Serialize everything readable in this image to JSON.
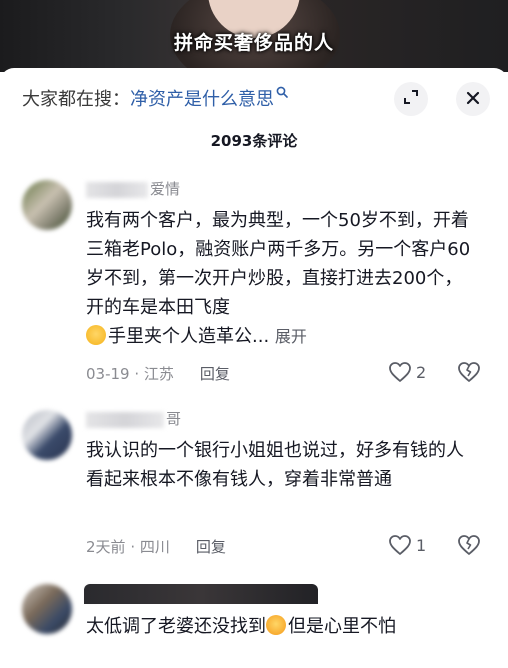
{
  "video": {
    "caption": "拼命买奢侈品的人"
  },
  "search": {
    "prefix": "大家都在搜：",
    "query": "净资产是什么意思"
  },
  "comments_count": "2093条评论",
  "comments": [
    {
      "username": "爱情",
      "text": "我有两个客户，最为典型，一个50岁不到，开着三箱老Polo，融资账户两千多万。另一个客户60岁不到，第一次开户炒股，直接打进去200个，开的车是本田飞度",
      "text_tail": "手里夹个人造革公...",
      "expand": "展开",
      "date": "03-19",
      "location": "江苏",
      "reply": "回复",
      "likes": "2"
    },
    {
      "username": "哥",
      "text": "我认识的一个银行小姐姐也说过，好多有钱的人看起来根本不像有钱人，穿着非常普通",
      "date": "2天前",
      "location": "四川",
      "reply": "回复",
      "likes": "1"
    },
    {
      "username": "ne",
      "text_head": "太低调了老婆还没找到",
      "text_tail": "但是心里不怕"
    }
  ],
  "icons": {
    "search": "search-icon",
    "expand": "expand-icon",
    "close": "close-icon",
    "like": "heart-icon",
    "dislike": "broken-heart-icon"
  },
  "colors": {
    "query_link": "#2f5fa8",
    "meta_gray": "#8a8b91"
  }
}
